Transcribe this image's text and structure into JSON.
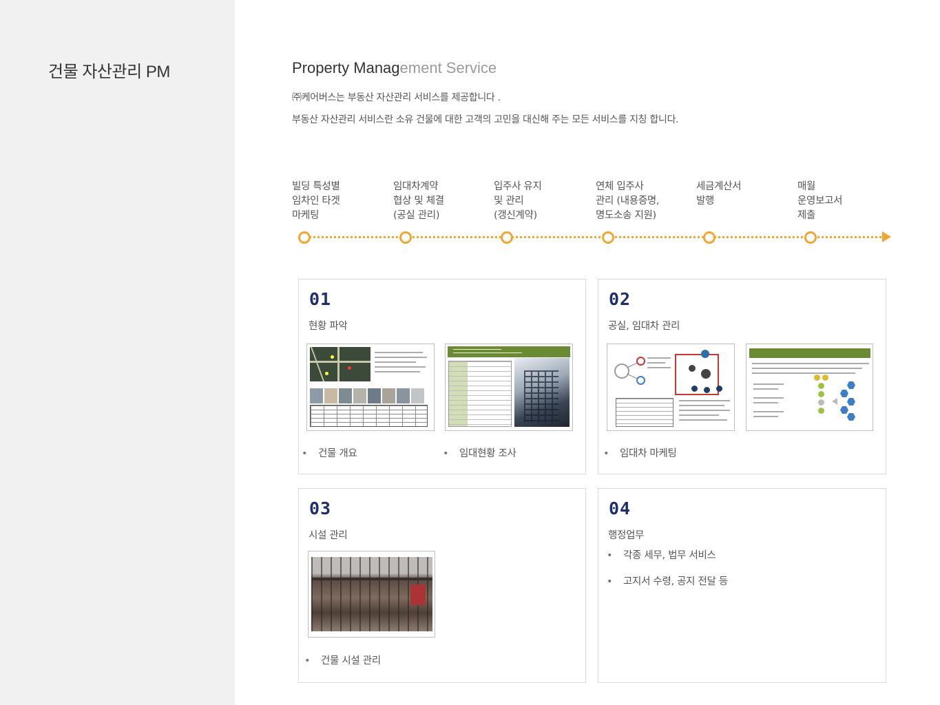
{
  "sidebar": {
    "title": "건물 자산관리 PM"
  },
  "header": {
    "title_dark": "Property Manag",
    "title_light": "ement Service",
    "intro_1": "㈜케어버스는 부동산 자산관리 서비스를 제공합니다 .",
    "intro_2": "부동산 자산관리 서비스란 소유 건물에 대한 고객의 고민을 대신해 주는 모든 서비스를 지칭 합니다."
  },
  "timeline": {
    "steps": [
      {
        "line1": "빌딩 특성별",
        "line2": "임차인 타겟",
        "line3": "마케팅"
      },
      {
        "line1": "임대차계약",
        "line2": "협상 및 체결",
        "line3": "(공실 관리)"
      },
      {
        "line1": "입주사 유지",
        "line2": "및 관리",
        "line3": "(갱신계약)"
      },
      {
        "line1": "연체 입주사",
        "line2": "관리 (내용증명,",
        "line3": "명도소송 지원)"
      },
      {
        "line1": "세금계산서",
        "line2": "발행",
        "line3": ""
      },
      {
        "line1": "매월",
        "line2": "운영보고서",
        "line3": "제출"
      }
    ],
    "accent_color": "#f2a531"
  },
  "cards": [
    {
      "number": "01",
      "title": "현황 파악",
      "bullets": [
        "건물 개요",
        "임대현황 조사"
      ]
    },
    {
      "number": "02",
      "title": "공실, 임대차 관리",
      "bullets": [
        "임대차 마케팅"
      ]
    },
    {
      "number": "03",
      "title": "시설 관리",
      "bullets": [
        "건물 시설 관리"
      ]
    },
    {
      "number": "04",
      "title": "행정업무",
      "bullets": [
        "각종 세무, 법무 서비스",
        "고지서 수령, 공지 전달 등"
      ]
    }
  ],
  "bullet_symbol": "•",
  "colors": {
    "card_number": "#1d2f6b",
    "sidebar_bg": "#f1f1f1",
    "green_header": "#6b8a34"
  }
}
